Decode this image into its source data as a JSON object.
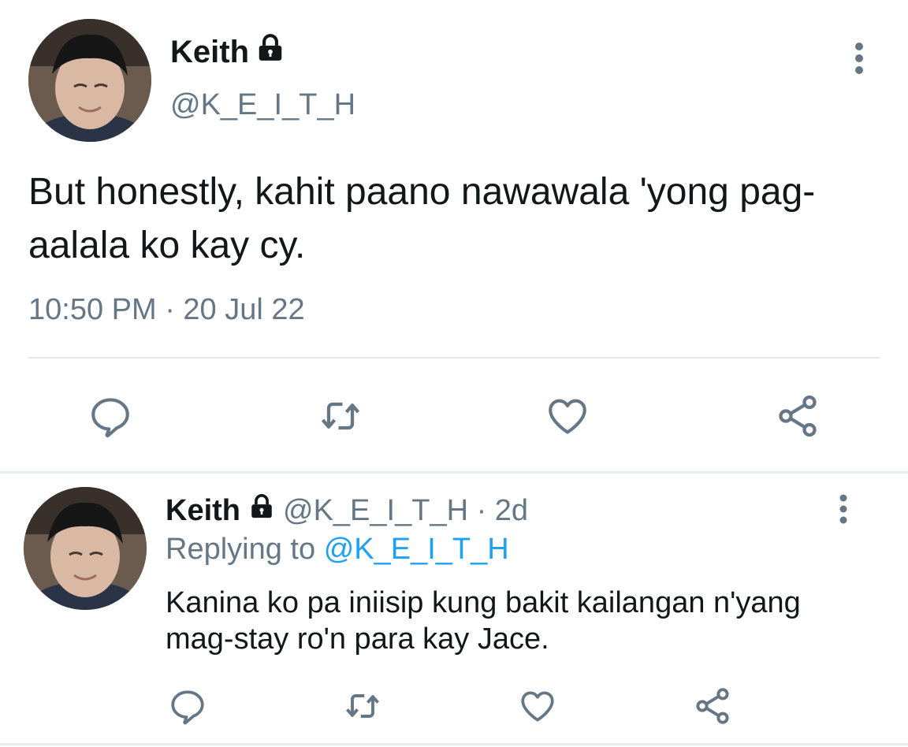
{
  "main_tweet": {
    "author_name": "Keith",
    "handle": "@K_E_I_T_H",
    "text": "But honestly, kahit paano nawawala 'yong pag-aalala ko kay cy.",
    "timestamp": "10:50 PM · 20 Jul 22",
    "icons": {
      "protected": "lock-icon",
      "more": "more-vertical-icon",
      "reply": "reply-icon",
      "retweet": "retweet-icon",
      "like": "heart-icon",
      "share": "share-icon"
    }
  },
  "reply_tweet": {
    "author_name": "Keith",
    "handle_time": "@K_E_I_T_H · 2d",
    "replying_prefix": "Replying to",
    "replying_to": "@K_E_I_T_H",
    "text": "Kanina ko pa iniisip kung bakit kailangan n'yang mag-stay ro'n para kay Jace."
  },
  "colors": {
    "text_primary": "#14171a",
    "text_secondary": "#657786",
    "mention": "#1da1f2",
    "icon": "#657786",
    "divider": "#e1e8ed"
  }
}
